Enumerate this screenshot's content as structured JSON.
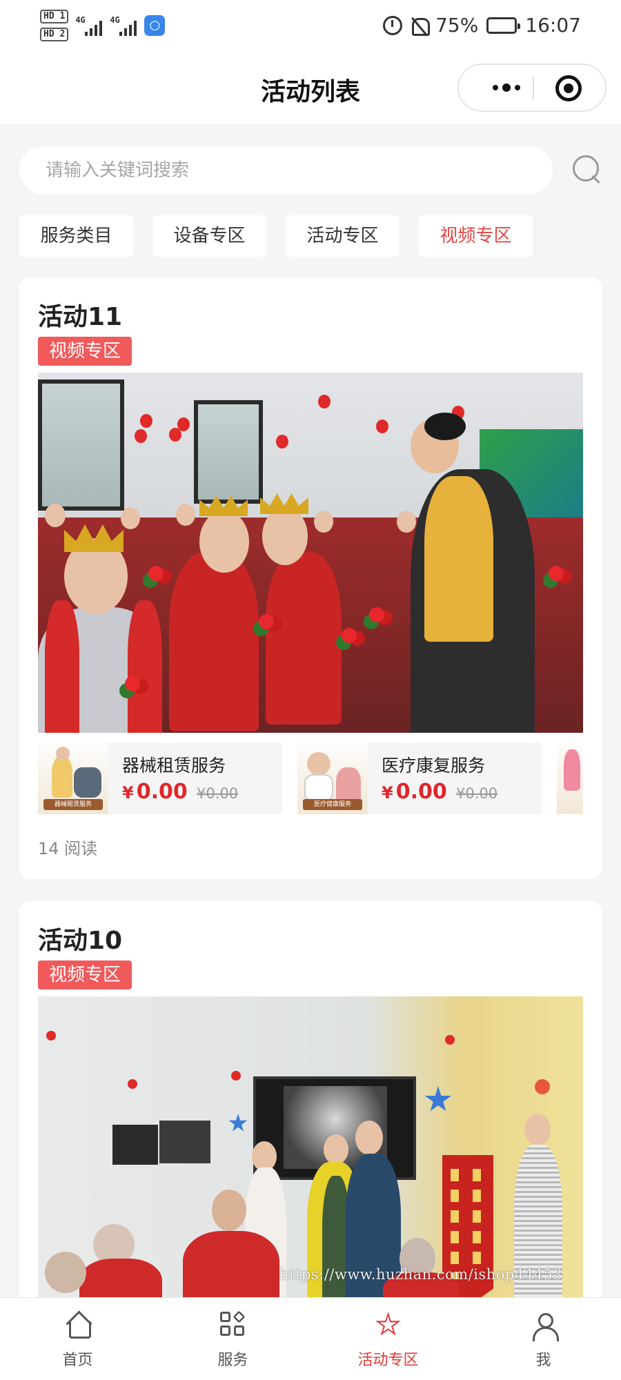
{
  "status_bar": {
    "sim1": "HD 1",
    "sim2": "HD 2",
    "network1": "4G",
    "network2": "4G",
    "battery": "75%",
    "battery_level": 0.75,
    "time": "16:07",
    "icons": [
      "alarm-icon",
      "mute-bell-icon",
      "battery-icon"
    ]
  },
  "header": {
    "title": "活动列表",
    "menu_icon": "more-dots-icon",
    "close_icon": "target-icon"
  },
  "search": {
    "placeholder": "请输入关键词搜索",
    "value": "",
    "icon": "search-icon"
  },
  "tabs": [
    {
      "label": "服务类目",
      "active": false
    },
    {
      "label": "设备专区",
      "active": false
    },
    {
      "label": "活动专区",
      "active": false
    },
    {
      "label": "视频专区",
      "active": true
    }
  ],
  "activities": [
    {
      "title": "活动11",
      "tag": "视频专区",
      "products": [
        {
          "name": "器械租赁服务",
          "price": "0.00",
          "currency": "¥",
          "old_price": "¥0.00",
          "thumb_label": "器械租赁服务"
        },
        {
          "name": "医疗康复服务",
          "price": "0.00",
          "currency": "¥",
          "old_price": "¥0.00",
          "thumb_label": "医疗健康服务"
        }
      ],
      "reads": "14 阅读"
    },
    {
      "title": "活动10",
      "tag": "视频专区"
    }
  ],
  "watermark": "https://www.huzhan.com/ishop44453",
  "tabbar": [
    {
      "label": "首页",
      "icon": "home-icon",
      "active": false
    },
    {
      "label": "服务",
      "icon": "grid-icon",
      "active": false
    },
    {
      "label": "活动专区",
      "icon": "star-icon",
      "active": true
    },
    {
      "label": "我",
      "icon": "user-icon",
      "active": false
    }
  ],
  "colors": {
    "accent": "#e23b3b",
    "tag_bg": "#f05a5a",
    "price": "#e0262b",
    "background": "#f5f5f5"
  }
}
